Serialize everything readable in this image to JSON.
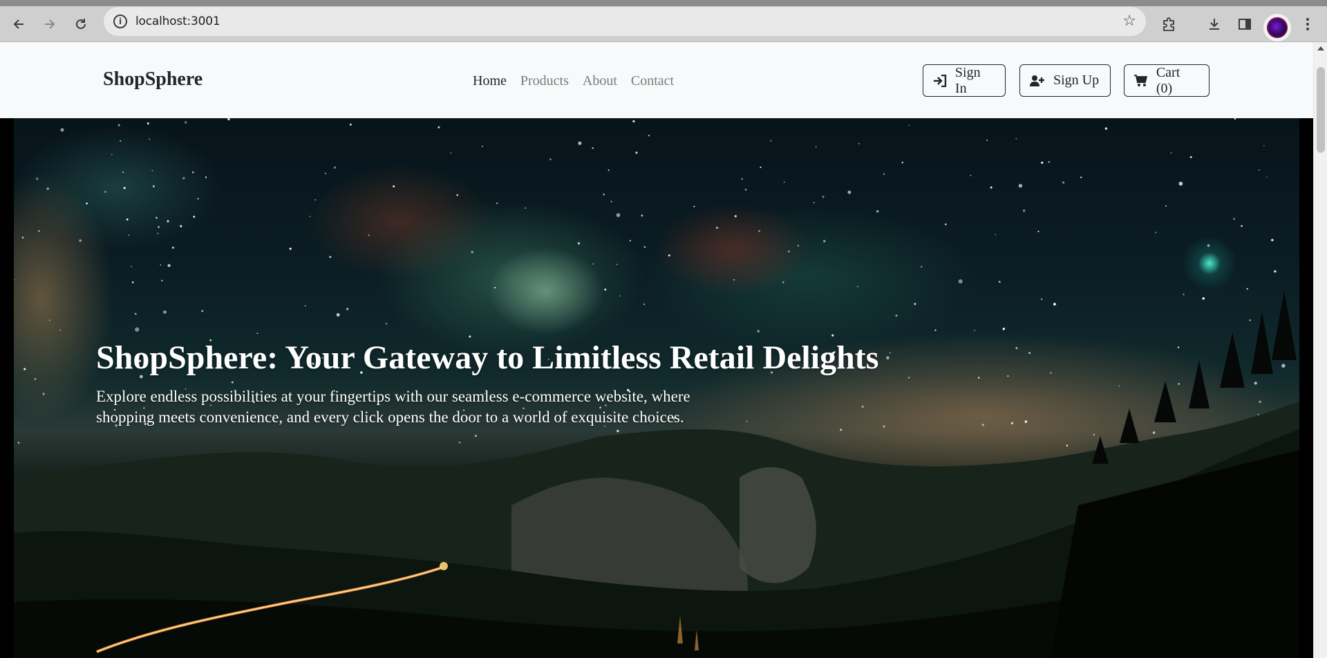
{
  "browser": {
    "url": "localhost:3001",
    "icons": [
      "back-arrow-icon",
      "forward-arrow-icon",
      "reload-icon",
      "site-info-icon",
      "bookmark-star-icon",
      "extensions-icon",
      "download-icon",
      "side-panel-icon",
      "profile-avatar",
      "more-menu-icon"
    ]
  },
  "site": {
    "brand": "ShopSphere",
    "nav": {
      "home": "Home",
      "products": "Products",
      "about": "About",
      "contact": "Contact"
    },
    "actions": {
      "sign_in": "Sign In",
      "sign_up": "Sign Up",
      "cart": "Cart (0)"
    }
  },
  "hero": {
    "title": "ShopSphere: Your Gateway to Limitless Retail Delights",
    "text": "Explore endless possibilities at your fingertips with our seamless e-commerce website, where shopping meets convenience, and every click opens the door to a world of exquisite choices."
  },
  "colors": {
    "navbar_bg": "#f8f9fa",
    "text_dark": "#212529",
    "nav_muted": "#7a7a7a",
    "hero_text": "#ffffff"
  }
}
